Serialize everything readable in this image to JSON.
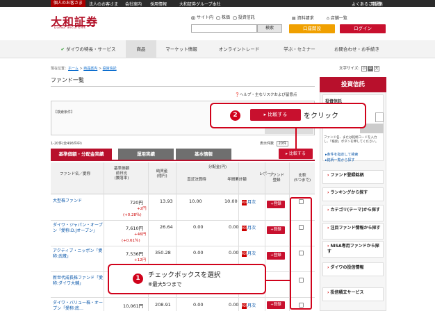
{
  "topbar": {
    "links": [
      "個人のお客さま",
      "法人のお客さま",
      "会社案内",
      "採用情報",
      "大和証券グループ本社"
    ],
    "right": [
      "よくあるご質問",
      "用語集"
    ]
  },
  "header": {
    "logo_jp": "大和証券",
    "logo_en": "Daiwa Securities",
    "search_options": [
      "サイト内",
      "株価",
      "投資信託"
    ],
    "search_button": "検索",
    "link_request": "資料請求",
    "link_store": "店舗一覧",
    "btn_open_account": "口座開設",
    "btn_login": "ログイン"
  },
  "nav": [
    "ダイワの特長・サービス",
    "商品",
    "マーケット情報",
    "オンライントレード",
    "学ぶ・セミナー",
    "お問合わせ・お手続き"
  ],
  "breadcrumb": {
    "prefix": "現在位置：",
    "items": [
      "ホーム",
      "商品案内",
      "投資信託"
    ]
  },
  "font_size": {
    "label": "文字サイズ:",
    "options": [
      "小",
      "中",
      "大"
    ]
  },
  "page_title": "ファンド一覧",
  "help_text": "ヘルプ・主なリスクおよび留意点",
  "search_condition": "【検索条件】",
  "result_count": "1-20件(全496件中)",
  "per_page": {
    "label": "表示件数",
    "value": "20件"
  },
  "tabs": [
    "基準価額・分配金実績",
    "運用実績",
    "基本情報"
  ],
  "compare_button": "比較する",
  "table": {
    "headers": {
      "fund": "ファンド名／愛称",
      "nav": "基準価額\n前日比\n(騰落率)",
      "assets": "純資産\n(億円)",
      "dist": "分配金(円)",
      "dist_recent": "直近決算時",
      "dist_year": "年間累計額",
      "report": "レポート",
      "register": "ファンド\n登録",
      "compare": "比較\n(5つまで)"
    },
    "rows": [
      {
        "fund": "大型株ファンド",
        "nav": "720円",
        "change": "+2円",
        "pct": "(+0.28％)",
        "assets": "13.93",
        "recent": "10.00",
        "year": "10.00",
        "report": "月次",
        "register": "+登録"
      },
      {
        "fund": "ダイワ・ジャパン・オープン「愛称:D.Jオープン」",
        "nav": "7,610円",
        "change": "+46円",
        "pct": "(+0.61％)",
        "assets": "26.64",
        "recent": "0.00",
        "year": "0.00",
        "report": "月次",
        "register": "+登録"
      },
      {
        "fund": "アクティブ・ニッポン「愛称:武蔵」",
        "nav": "7,536円",
        "change": "+12円",
        "pct": "",
        "assets": "350.28",
        "recent": "0.00",
        "year": "0.00",
        "report": "月次",
        "register": "+登録"
      },
      {
        "fund": "新世代成長株ファンド「愛称:ダイワ大輔」",
        "nav": "",
        "change": "",
        "pct": "",
        "assets": "",
        "recent": "",
        "year": "",
        "report": "",
        "register": ""
      },
      {
        "fund": "ダイワ・バリュー株・オープン「愛称:底…",
        "nav": "10,061円",
        "change": "",
        "pct": "",
        "assets": "208.91",
        "recent": "0.00",
        "year": "0.00",
        "report": "月次",
        "register": "+登録"
      }
    ]
  },
  "callout2": {
    "num": "2",
    "button": "比較する",
    "text": "をクリック"
  },
  "callout1": {
    "num": "1",
    "text": "チェックボックスを選択",
    "sub": "※最大5つまで"
  },
  "sidebar": {
    "title": "投資信託",
    "sub": "投資信託",
    "note": "ファンド名、または銘柄コードを入力し、「検索」ボタンを押してください。",
    "link1": "条件を指定して検索",
    "link2": "銘柄一覧から探す",
    "items": [
      "ファンド登録銘柄",
      "ランキングから探す",
      "カテゴリ(テーマ)から探す",
      "注目ファンド情報から探す",
      "NISA専用ファンドから探す",
      "ダイワの投信情報",
      "投信積立サービス"
    ]
  },
  "colors": {
    "brand": "#b3132a",
    "accent": "#d0021b",
    "open": "#f0a000"
  }
}
